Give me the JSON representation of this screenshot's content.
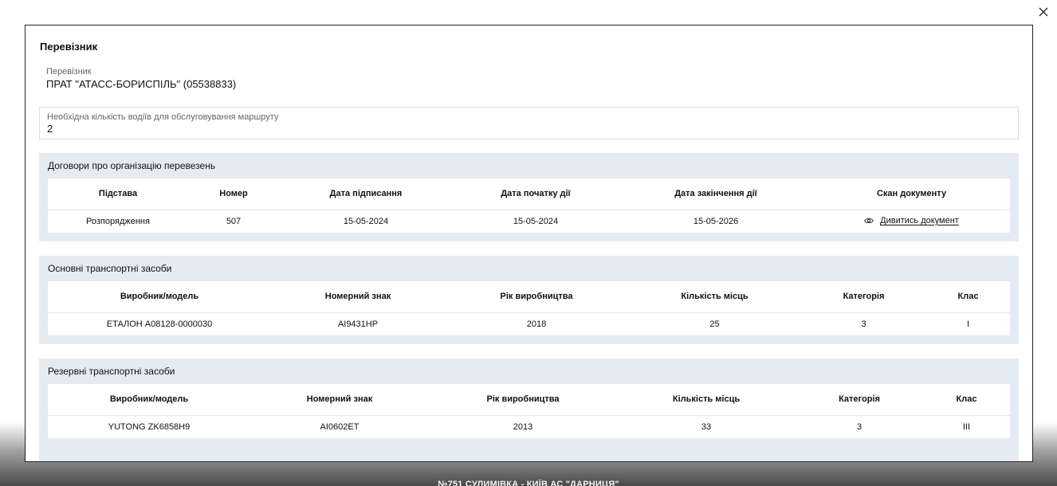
{
  "modal": {
    "title": "Перевізник",
    "close_icon": "close-icon"
  },
  "carrier": {
    "label": "Перевізник",
    "value": "ПРАТ \"АТАСС-БОРИСПІЛЬ\" (05538833)"
  },
  "drivers": {
    "label": "Необхідна кількість водіїв для обслуговування маршруту",
    "value": "2"
  },
  "contracts": {
    "title": "Договори про організацію перевезень",
    "headers": [
      "Підстава",
      "Номер",
      "Дата підписання",
      "Дата початку дії",
      "Дата закінчення дії",
      "Скан документу"
    ],
    "rows": [
      {
        "basis": "Розпорядження",
        "number": "507",
        "signed": "15-05-2024",
        "start": "15-05-2024",
        "end": "15-05-2026",
        "scan_link": "Дивитись документ",
        "scan_icon": "eye-icon"
      }
    ]
  },
  "main_vehicles": {
    "title": "Основні транспортні засоби",
    "headers": [
      "Виробник/модель",
      "Номерний знак",
      "Рік виробництва",
      "Кількість місць",
      "Категорія",
      "Клас"
    ],
    "rows": [
      {
        "model": "ЕТАЛОН А08128-0000030",
        "plate": "АІ9431НР",
        "year": "2018",
        "seats": "25",
        "category": "3",
        "class": "I"
      }
    ]
  },
  "reserve_vehicles": {
    "title": "Резервні транспортні засоби",
    "headers": [
      "Виробник/модель",
      "Номерний знак",
      "Рік виробництва",
      "Кількість місць",
      "Категорія",
      "Клас"
    ],
    "rows": [
      {
        "model": "YUTONG ZK6858H9",
        "plate": "АІ0602ЕТ",
        "year": "2013",
        "seats": "33",
        "category": "3",
        "class": "III"
      }
    ]
  },
  "background": {
    "caption": "№751 СУЛИМІВКА - КИЇВ АС \"ДАРНИЦЯ\""
  }
}
